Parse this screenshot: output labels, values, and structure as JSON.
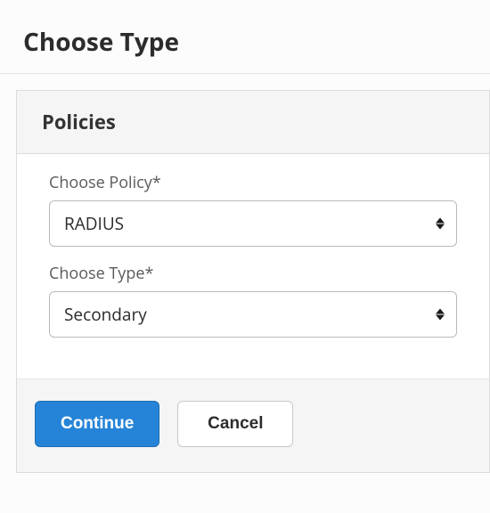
{
  "header": {
    "title": "Choose Type"
  },
  "panel": {
    "title": "Policies"
  },
  "fields": {
    "policy": {
      "label": "Choose Policy*",
      "value": "RADIUS"
    },
    "type": {
      "label": "Choose Type*",
      "value": "Secondary"
    }
  },
  "buttons": {
    "continue": "Continue",
    "cancel": "Cancel"
  }
}
